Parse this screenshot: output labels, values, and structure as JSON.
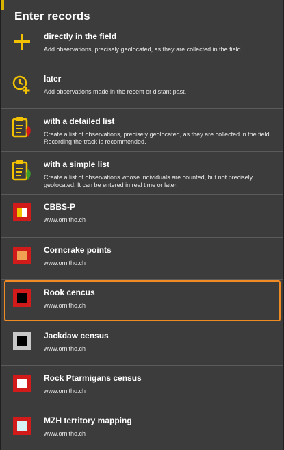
{
  "dialog": {
    "title": "Enter records"
  },
  "items": [
    {
      "title": "directly in the field",
      "desc": "Add observations, precisely geolocated, as they are collected in the field.",
      "icon": "plus-icon"
    },
    {
      "title": "later",
      "desc": "Add observations made in the recent or distant past.",
      "icon": "clock-plus-icon"
    },
    {
      "title": "with a detailed list",
      "desc": "Create a list of observations, precisely geolocated, as they are collected in the field. Recording the track is recommended.",
      "icon": "clipboard-red-icon"
    },
    {
      "title": "with a simple list",
      "desc": "Create a list of observations whose individuals are counted, but not precisely geolocated. It can be entered in real time or later.",
      "icon": "clipboard-green-icon"
    },
    {
      "title": "CBBS-P",
      "desc": "www.ornitho.ch",
      "icon": "cbbs-p-icon",
      "outer_color": "#d11a1a",
      "inner_color": "#f2c200",
      "inner_color_2": "#ffffff"
    },
    {
      "title": "Corncrake points",
      "desc": "www.ornitho.ch",
      "icon": "corncrake-icon",
      "outer_color": "#d11a1a",
      "inner_color": "#f0a050"
    },
    {
      "title": "Rook cencus",
      "desc": "www.ornitho.ch",
      "icon": "rook-icon",
      "outer_color": "#d11a1a",
      "inner_color": "#000000",
      "selected": true
    },
    {
      "title": "Jackdaw census",
      "desc": "www.ornitho.ch",
      "icon": "jackdaw-icon",
      "outer_color": "#c8c8c8",
      "inner_color": "#000000"
    },
    {
      "title": "Rock Ptarmigans census",
      "desc": "www.ornitho.ch",
      "icon": "ptarmigan-icon",
      "outer_color": "#d11a1a",
      "inner_color": "#ffffff"
    },
    {
      "title": "MZH territory mapping",
      "desc": "www.ornitho.ch",
      "icon": "mzh-icon",
      "outer_color": "#d11a1a",
      "inner_color": "#d6f0f4"
    }
  ],
  "colors": {
    "accent_yellow": "#f2c200",
    "selection_border": "#f08a24"
  }
}
